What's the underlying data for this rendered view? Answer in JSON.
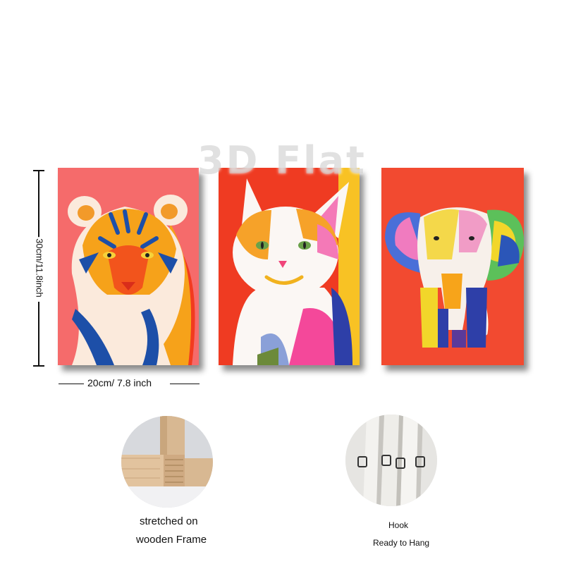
{
  "watermark": "3D Flat",
  "dimensions": {
    "height_label": "30cm/11.8inch",
    "width_label": "20cm/ 7.8 inch"
  },
  "panels": [
    {
      "name": "tiger-painting",
      "subject": "tiger",
      "background": "#f56b6b"
    },
    {
      "name": "cat-painting",
      "subject": "cat",
      "background": "#ef3b22"
    },
    {
      "name": "elephant-painting",
      "subject": "elephant",
      "background": "#f24a30"
    }
  ],
  "features": {
    "frame": {
      "line1": "stretched on",
      "line2": "wooden Frame"
    },
    "hook": {
      "line1": "Hook",
      "line2": "Ready to Hang"
    }
  }
}
